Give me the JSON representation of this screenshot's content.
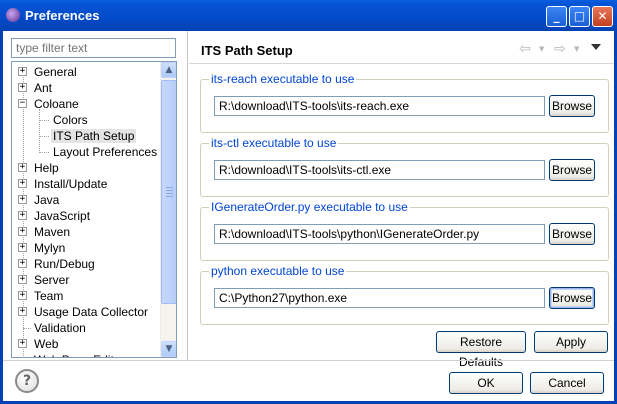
{
  "window": {
    "title": "Preferences",
    "minimize_glyph": "_",
    "maximize_glyph": "□",
    "close_glyph": "✕"
  },
  "filter": {
    "placeholder": "type filter text"
  },
  "tree": {
    "items": [
      {
        "label": "General",
        "expander": "+"
      },
      {
        "label": "Ant",
        "expander": "+"
      },
      {
        "label": "Coloane",
        "expander": "−"
      },
      {
        "label": "Colors",
        "expander": ""
      },
      {
        "label": "ITS Path Setup",
        "expander": "",
        "selected": true
      },
      {
        "label": "Layout Preferences",
        "expander": ""
      },
      {
        "label": "Help",
        "expander": "+"
      },
      {
        "label": "Install/Update",
        "expander": "+"
      },
      {
        "label": "Java",
        "expander": "+"
      },
      {
        "label": "JavaScript",
        "expander": "+"
      },
      {
        "label": "Maven",
        "expander": "+"
      },
      {
        "label": "Mylyn",
        "expander": "+"
      },
      {
        "label": "Run/Debug",
        "expander": "+"
      },
      {
        "label": "Server",
        "expander": "+"
      },
      {
        "label": "Team",
        "expander": "+"
      },
      {
        "label": "Usage Data Collector",
        "expander": "+"
      },
      {
        "label": "Validation",
        "expander": ""
      },
      {
        "label": "Web",
        "expander": "+"
      },
      {
        "label": "Web Page Editor",
        "expander": ""
      }
    ],
    "scroll_up": "▲",
    "scroll_down": "▼"
  },
  "page": {
    "title": "ITS Path Setup",
    "back_glyph": "⇦",
    "forward_glyph": "⇨",
    "dropdown_glyph": "▼"
  },
  "groups": [
    {
      "legend": "its-reach executable to use",
      "value": "R:\\download\\ITS-tools\\its-reach.exe",
      "button": "Browse"
    },
    {
      "legend": "its-ctl executable to use",
      "value": "R:\\download\\ITS-tools\\its-ctl.exe",
      "button": "Browse"
    },
    {
      "legend": "IGenerateOrder.py executable to use",
      "value": "R:\\download\\ITS-tools\\python\\IGenerateOrder.py",
      "button": "Browse"
    },
    {
      "legend": "python executable to use",
      "value": "C:\\Python27\\python.exe",
      "button": "Browse"
    }
  ],
  "actions": {
    "restore_defaults": "Restore Defaults",
    "apply": "Apply"
  },
  "footer": {
    "help": "?",
    "ok": "OK",
    "cancel": "Cancel"
  },
  "colors": {
    "titlebar": "#0342b4",
    "legend": "#0046d5"
  }
}
